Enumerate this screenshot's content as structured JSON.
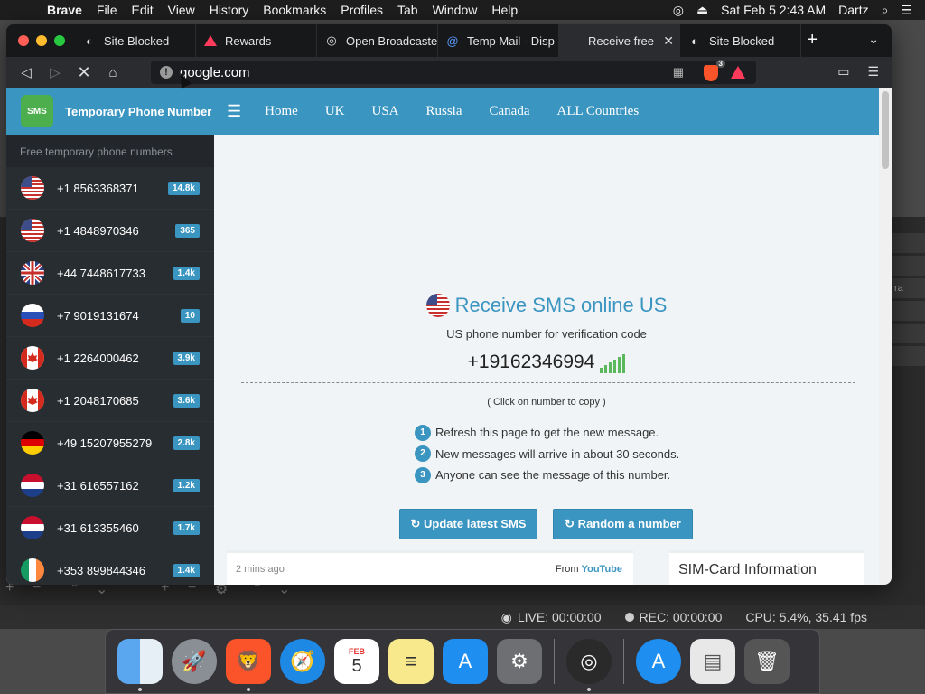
{
  "menubar": {
    "app_name": "Brave",
    "items": [
      "File",
      "Edit",
      "View",
      "History",
      "Bookmarks",
      "Profiles",
      "Tab",
      "Window",
      "Help"
    ],
    "datetime": "Sat Feb 5  2:43 AM",
    "user": "Dartz"
  },
  "browser": {
    "tabs": [
      {
        "title": "Site Blocked",
        "icon": "globe-icon"
      },
      {
        "title": "Rewards",
        "icon": "brave-rewards-icon"
      },
      {
        "title": "Open Broadcaste",
        "icon": "obs-icon"
      },
      {
        "title": "Temp Mail - Disp",
        "icon": "at-icon"
      },
      {
        "title": "Receive free",
        "icon": "loading-icon"
      },
      {
        "title": "Site Blocked",
        "icon": "globe-icon"
      }
    ],
    "url": "google.com",
    "shield_count": "3"
  },
  "site": {
    "brand": "Temporary Phone Number",
    "logo_text": "SMS",
    "nav": [
      "Home",
      "UK",
      "USA",
      "Russia",
      "Canada",
      "ALL Countries"
    ],
    "sidebar_heading": "Free temporary phone numbers",
    "numbers": [
      {
        "number": "+1 8563368371",
        "count": "14.8k",
        "flag": "us"
      },
      {
        "number": "+1 4848970346",
        "count": "365",
        "flag": "us"
      },
      {
        "number": "+44 7448617733",
        "count": "1.4k",
        "flag": "uk"
      },
      {
        "number": "+7 9019131674",
        "count": "10",
        "flag": "ru"
      },
      {
        "number": "+1 2264000462",
        "count": "3.9k",
        "flag": "ca"
      },
      {
        "number": "+1 2048170685",
        "count": "3.6k",
        "flag": "ca"
      },
      {
        "number": "+49 15207955279",
        "count": "2.8k",
        "flag": "de"
      },
      {
        "number": "+31 616557162",
        "count": "1.2k",
        "flag": "nl"
      },
      {
        "number": "+31 613355460",
        "count": "1.7k",
        "flag": "nl"
      },
      {
        "number": "+353 899844346",
        "count": "1.4k",
        "flag": "ie"
      }
    ],
    "hero_title": "Receive SMS online US",
    "hero_subtitle": "US phone number for verification code",
    "phone_number": "+19162346994",
    "copy_hint": "( Click on number to copy )",
    "steps": [
      "Refresh this page to get the new message.",
      "New messages will arrive in about 30 seconds.",
      "Anyone can see the message of this number."
    ],
    "btn_update": "↻ Update latest SMS",
    "btn_random": "↻ Random a number",
    "message_time": "2 mins ago",
    "message_from_label": "From",
    "message_from": "YouTube",
    "sim_title": "SIM-Card Information"
  },
  "obs": {
    "live": "LIVE: 00:00:00",
    "rec": "REC: 00:00:00",
    "cpu": "CPU: 5.4%, 35.41 fps",
    "side_text": "ra"
  },
  "dock": {
    "apps": [
      "finder-icon",
      "launchpad-icon",
      "brave-icon",
      "safari-icon",
      "calendar-icon",
      "notes-icon",
      "app-store-icon",
      "system-preferences-icon",
      "obs-icon",
      "app-store-downloads-icon",
      "document-icon",
      "trash-icon"
    ],
    "calendar_month": "FEB",
    "calendar_day": "5"
  }
}
